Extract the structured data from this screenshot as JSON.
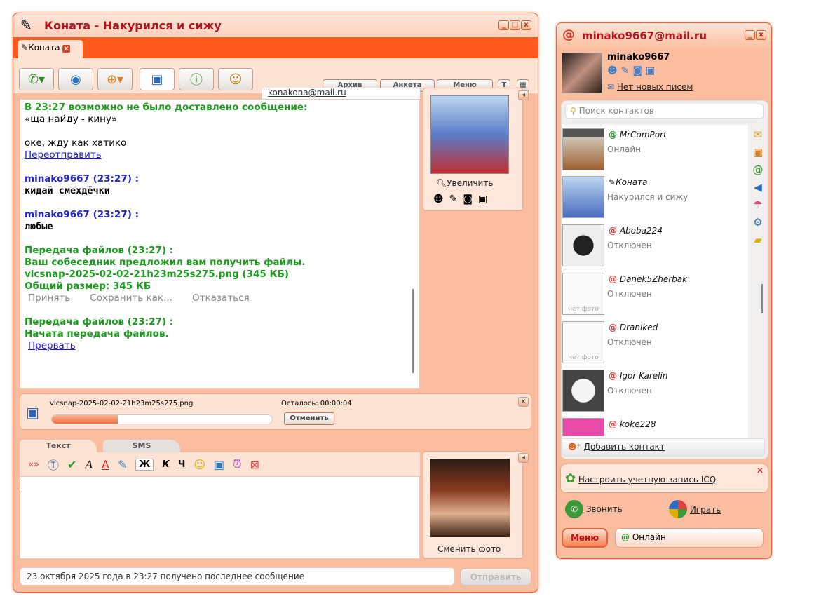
{
  "chat_window": {
    "title": "Коната - Накурился и сижу",
    "tab_label": "Коната",
    "toolbar_buttons": [
      "call",
      "webcam",
      "games",
      "save",
      "info",
      "group"
    ],
    "archive": "Архив",
    "profile": "Анкета",
    "menu": "Меню",
    "contact_email": "konakona@mail.ru",
    "messages": {
      "warn": "В 23:27 возможно не было доставлено сообщение:",
      "quote": "«ща найду - кину»",
      "own": "оке, жду как хатико",
      "resend": "Переотправить",
      "m1_head": "minako9667 (23:27) :",
      "m1_body": "кидай смехдёчки",
      "m2_head": "minako9667 (23:27) :",
      "m2_body": "любые",
      "ft1_head": "Передача файлов (23:27) :",
      "ft1_l1": "Ваш собеседник предложил вам получить файлы.",
      "ft1_l2": "vlcsnap-2025-02-02-21h23m25s275.png (345 КБ)",
      "ft1_l3": "Общий размер: 345 КБ",
      "accept": "Принять",
      "save_as": "Сохранить как...",
      "decline": "Отказаться",
      "ft2_head": "Передача файлов (23:27) :",
      "ft2_l1": "Начата передача файлов.",
      "abort": "Прервать"
    },
    "zoom": "Увеличить",
    "transfer": {
      "file": "vlcsnap-2025-02-02-21h23m25s275.png",
      "remaining": "Осталось: 00:00:04",
      "progress_percent": 30,
      "cancel": "Отменить"
    },
    "tabs": {
      "text": "Текст",
      "sms": "SMS"
    },
    "format": {
      "bold": "Ж",
      "italic": "К",
      "underline": "Ч"
    },
    "change_photo": "Сменить фото",
    "status": "23 октября 2025 года в 23:27 получено последнее сообщение",
    "send": "Отправить"
  },
  "contact_window": {
    "title": "minako9667@mail.ru",
    "username": "minako9667",
    "mail": "Нет новых писем",
    "search_placeholder": "Поиск контактов",
    "contacts": [
      {
        "name": "MrComPort",
        "status": "Онлайн"
      },
      {
        "name": "Коната",
        "status": "Накурился и сижу"
      },
      {
        "name": "Aboba224",
        "status": "Отключен"
      },
      {
        "name": "Danek5Zherbak",
        "status": "Отключен"
      },
      {
        "name": "Draniked",
        "status": "Отключен"
      },
      {
        "name": "Igor Karelin",
        "status": "Отключен"
      },
      {
        "name": "koke228",
        "status": ""
      }
    ],
    "no_photo": "нет фото",
    "add_contact": "Добавить контакт",
    "icq": "Настроить учетную запись ICQ",
    "call": "Звонить",
    "play": "Играть",
    "menu": "Меню",
    "presence": "Онлайн",
    "accent": "#ff5a1e"
  }
}
